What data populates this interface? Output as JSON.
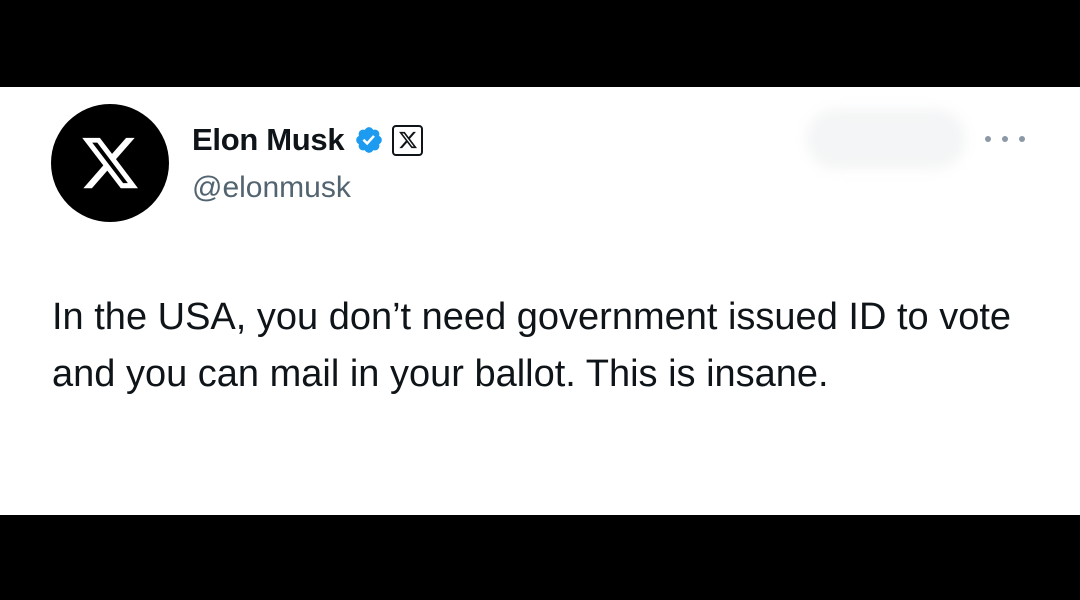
{
  "tweet": {
    "author": {
      "display_name": "Elon Musk",
      "handle": "@elonmusk",
      "avatar_icon": "x-logo-icon",
      "verified_icon": "verified-badge-icon",
      "affiliation_icon": "x-affiliate-badge-icon"
    },
    "text": "In the USA, you don’t need government issued ID to vote and you can mail in your ballot. This is insane.",
    "more_icon": "more-options-icon"
  },
  "colors": {
    "verified_blue": "#1d9bf0",
    "text_primary": "#0f1419",
    "text_secondary": "#536471",
    "background": "#ffffff",
    "letterbox": "#000000"
  }
}
